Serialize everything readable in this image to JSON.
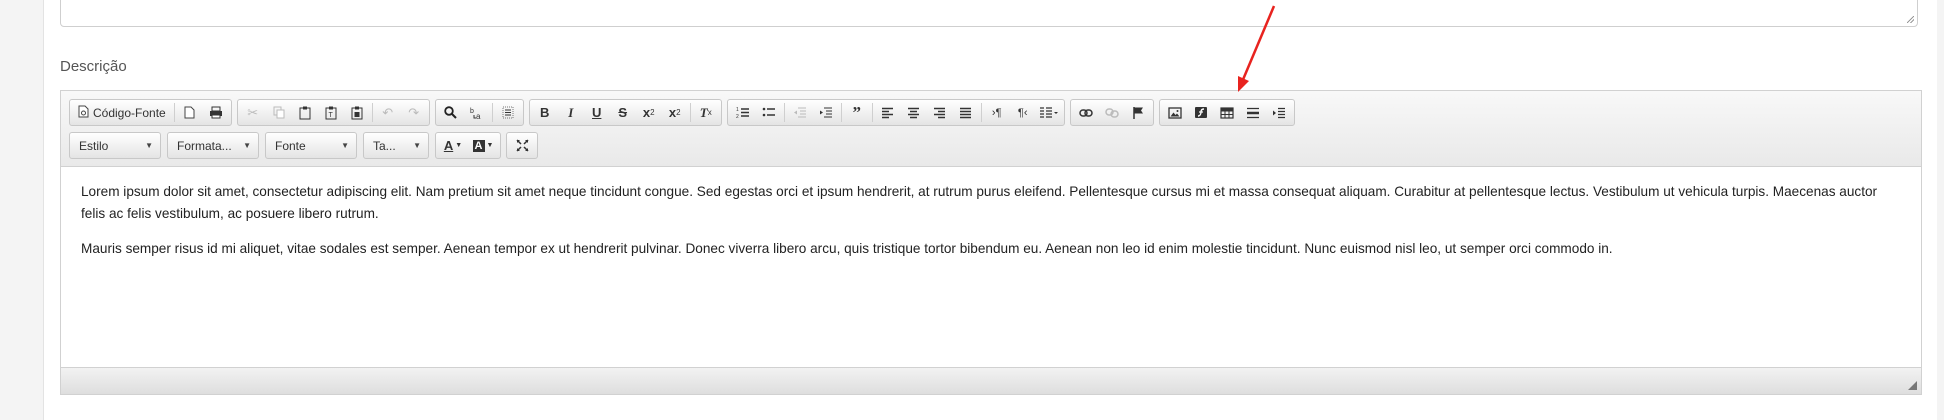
{
  "form": {
    "description_label": "Descrição"
  },
  "toolbar": {
    "source_label": "Código-Fonte",
    "style_combo": "Estilo",
    "format_combo": "Formata...",
    "font_combo": "Fonte",
    "size_combo": "Ta..."
  },
  "content": {
    "paragraph1": "Lorem ipsum dolor sit amet, consectetur adipiscing elit. Nam pretium sit amet neque tincidunt congue. Sed egestas orci et ipsum hendrerit, at rutrum purus eleifend. Pellentesque cursus mi et massa consequat aliquam. Curabitur at pellentesque lectus. Vestibulum ut vehicula turpis. Maecenas auctor felis ac felis vestibulum, ac posuere libero rutrum.",
    "paragraph2": "Mauris semper risus id mi aliquet, vitae sodales est semper. Aenean tempor ex ut hendrerit pulvinar. Donec viverra libero arcu, quis tristique tortor bibendum eu. Aenean non leo id enim molestie tincidunt. Nunc euismod nisl leo, ut semper orci commodo in."
  },
  "colors": {
    "annotation_arrow": "#e8231f"
  },
  "icons": {
    "annotation": "red-arrow-pointing-to-image-button"
  }
}
